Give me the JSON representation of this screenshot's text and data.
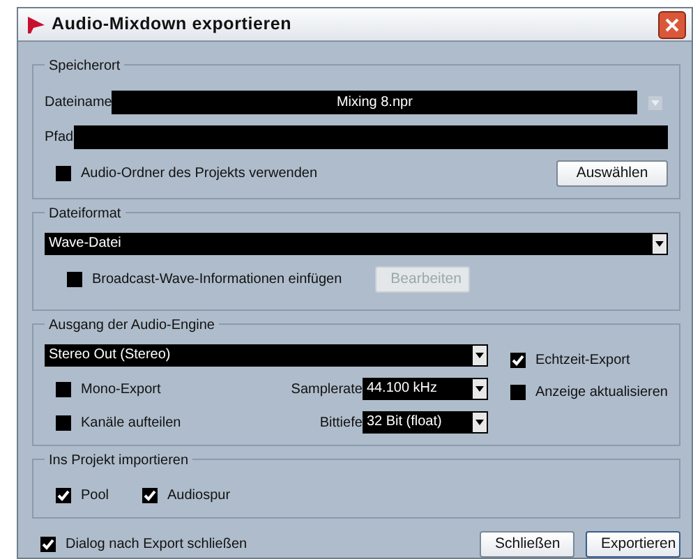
{
  "window": {
    "title": "Audio-Mixdown exportieren"
  },
  "location": {
    "title": "Speicherort",
    "filename_label": "Dateiname",
    "filename": "Mixing 8.npr",
    "path_label": "Pfad",
    "use_project_folder": {
      "label": "Audio-Ordner des Projekts verwenden",
      "checked": false
    },
    "choose_button": "Auswählen"
  },
  "file_format": {
    "title": "Dateiformat",
    "format": "Wave-Datei",
    "broadcast_wave": {
      "label": "Broadcast-Wave-Informationen einfügen",
      "checked": false
    },
    "edit_button": {
      "label": "Bearbeiten",
      "disabled": true
    }
  },
  "engine_output": {
    "title": "Ausgang der Audio-Engine",
    "output": "Stereo Out (Stereo)",
    "options": [
      {
        "label": "Mono-Export",
        "checked": false
      },
      {
        "label": "Kanäle aufteilen",
        "checked": false
      }
    ],
    "samplerate_label": "Samplerate",
    "samplerate": "44.100 kHz",
    "bitdepth_label": "Bittiefe",
    "bitdepth": "32 Bit (float)",
    "right_options": [
      {
        "label": "Echtzeit-Export",
        "checked": true
      },
      {
        "label": "Anzeige aktualisieren",
        "checked": false
      }
    ]
  },
  "import": {
    "title": "Ins Projekt importieren",
    "options": [
      {
        "label": "Pool",
        "checked": true
      },
      {
        "label": "Audiospur",
        "checked": true
      }
    ]
  },
  "footer": {
    "close_dialog": {
      "label": "Dialog nach Export schließen",
      "checked": true
    },
    "buttons": [
      "Schließen",
      "Exportieren"
    ]
  }
}
